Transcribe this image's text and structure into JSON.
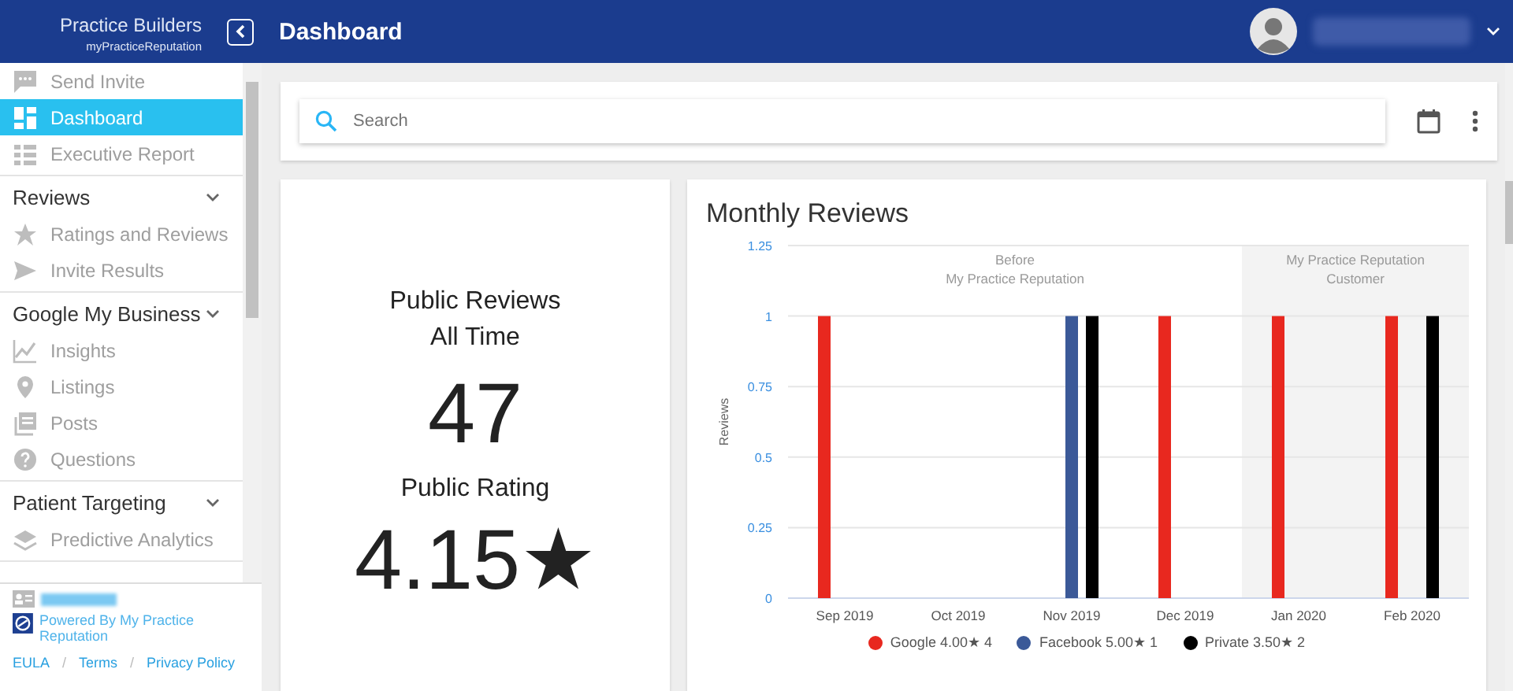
{
  "header": {
    "logo_name": "Practice Builders",
    "logo_sub": "myPracticeReputation",
    "title": "Dashboard"
  },
  "sidebar": {
    "sections": [
      {
        "items": [
          {
            "label": "Send Invite",
            "selected": false
          },
          {
            "label": "Dashboard",
            "selected": true
          },
          {
            "label": "Executive Report",
            "selected": false
          }
        ]
      },
      {
        "title": "Reviews",
        "expanded": true,
        "items": [
          {
            "label": "Ratings and Reviews",
            "selected": false
          },
          {
            "label": "Invite Results",
            "selected": false
          }
        ]
      },
      {
        "title": "Google My Business",
        "expanded": true,
        "items": [
          {
            "label": "Insights",
            "selected": false
          },
          {
            "label": "Listings",
            "selected": false
          },
          {
            "label": "Posts",
            "selected": false
          },
          {
            "label": "Questions",
            "selected": false
          }
        ]
      },
      {
        "title": "Patient Targeting",
        "expanded": true,
        "items": [
          {
            "label": "Predictive Analytics",
            "selected": false
          }
        ]
      }
    ],
    "footer": {
      "powered": "Powered By My Practice Reputation",
      "links": [
        "EULA",
        "Terms",
        "Privacy Policy"
      ],
      "separator": "/"
    }
  },
  "search": {
    "placeholder": "Search"
  },
  "summary": {
    "heading": "Public Reviews\nAll Time",
    "count": "47",
    "rating_label": "Public Rating",
    "rating": "4.15★"
  },
  "monthly": {
    "title": "Monthly Reviews",
    "chart_data": {
      "type": "bar",
      "ylabel": "Reviews",
      "categories": [
        "Sep 2019",
        "Oct 2019",
        "Nov 2019",
        "Dec 2019",
        "Jan 2020",
        "Feb 2020"
      ],
      "series": [
        {
          "name": "Google 4.00★ 4",
          "color": "#e8281f",
          "values": [
            1,
            0,
            0,
            1,
            1,
            1
          ]
        },
        {
          "name": "Facebook 5.00★ 1",
          "color": "#3b5998",
          "values": [
            0,
            0,
            1,
            0,
            0,
            0
          ]
        },
        {
          "name": "Private 3.50★ 2",
          "color": "#000000",
          "values": [
            0,
            0,
            1,
            0,
            0,
            1
          ]
        }
      ],
      "ylim": [
        0,
        1.25
      ],
      "yticks": [
        0,
        0.25,
        0.5,
        0.75,
        1,
        1.25
      ],
      "grid": true,
      "annotations": [
        {
          "text": "Before\nMy Practice Reputation"
        },
        {
          "text": "My Practice Reputation\nCustomer"
        }
      ]
    }
  }
}
